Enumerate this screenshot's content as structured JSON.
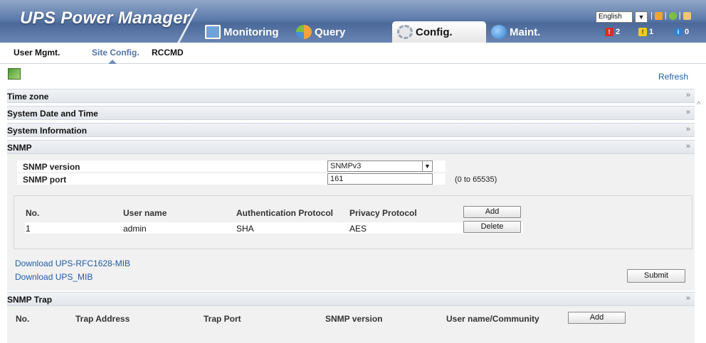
{
  "app": {
    "title": "UPS Power Manager"
  },
  "nav": {
    "tabs": [
      {
        "label": "Monitoring",
        "icon": "monitor-icon"
      },
      {
        "label": "Query",
        "icon": "pie-chart-icon"
      },
      {
        "label": "Config.",
        "icon": "gear-icon",
        "active": true
      },
      {
        "label": "Maint.",
        "icon": "globe-icon"
      }
    ]
  },
  "header_tools": {
    "language": "English",
    "alarms": {
      "critical": "2",
      "warning": "1",
      "info": "0"
    }
  },
  "subnav": {
    "items": [
      "User Mgmt.",
      "Site Config.",
      "RCCMD"
    ],
    "active": "Site Config."
  },
  "toolbar": {
    "refresh_label": "Refresh"
  },
  "sections": {
    "time_zone": "Time zone",
    "date_time": "System Date and Time",
    "system_info": "System Information",
    "snmp": "SNMP",
    "snmp_trap": "SNMP Trap"
  },
  "snmp": {
    "version_label": "SNMP version",
    "version_value": "SNMPv3",
    "port_label": "SNMP port",
    "port_value": "161",
    "port_range": "(0 to 65535)",
    "users_table": {
      "columns": [
        "No.",
        "User name",
        "Authentication Protocol",
        "Privacy Protocol"
      ],
      "rows": [
        {
          "no": "1",
          "user": "admin",
          "auth": "SHA",
          "priv": "AES"
        }
      ],
      "add_label": "Add",
      "delete_label": "Delete"
    },
    "download_links": [
      "Download UPS-RFC1628-MIB",
      "Download UPS_MIB"
    ],
    "submit_label": "Submit"
  },
  "trap": {
    "columns": [
      "No.",
      "Trap Address",
      "Trap Port",
      "SNMP version",
      "User name/Community"
    ],
    "add_label": "Add"
  }
}
